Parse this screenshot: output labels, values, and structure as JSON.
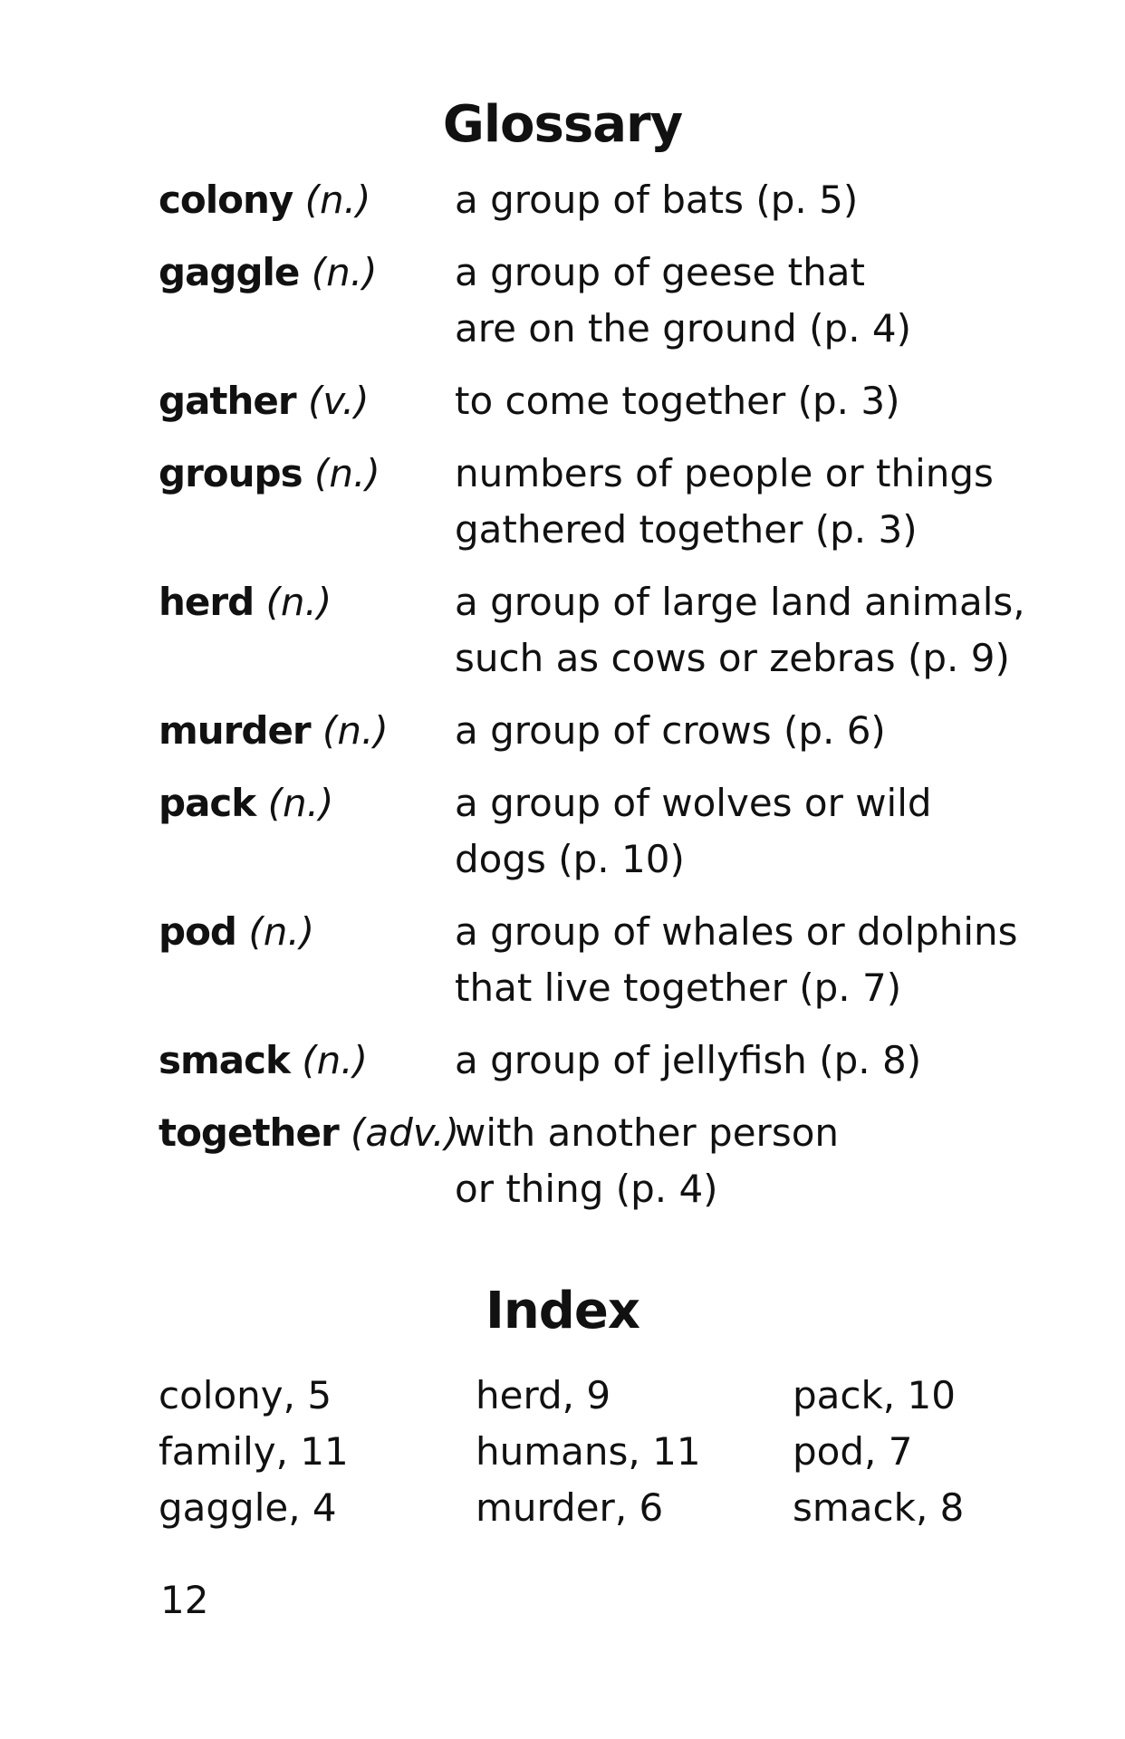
{
  "glossary": {
    "title": "Glossary",
    "entries": [
      {
        "term": "colony",
        "pos": "(n.)",
        "lines": [
          "a group of bats (p. 5)"
        ]
      },
      {
        "term": "gaggle",
        "pos": "(n.)",
        "lines": [
          "a group of geese that",
          "are on the ground (p. 4)"
        ]
      },
      {
        "term": "gather",
        "pos": "(v.)",
        "lines": [
          "to come together (p. 3)"
        ]
      },
      {
        "term": "groups",
        "pos": "(n.)",
        "lines": [
          "numbers of people or things",
          "gathered together (p. 3)"
        ]
      },
      {
        "term": "herd",
        "pos": "(n.)",
        "lines": [
          "a group of large land animals,",
          "such as cows or zebras (p. 9)"
        ]
      },
      {
        "term": "murder",
        "pos": "(n.)",
        "lines": [
          "a group of crows (p. 6)"
        ]
      },
      {
        "term": "pack",
        "pos": "(n.)",
        "lines": [
          "a group of wolves or wild",
          "dogs (p. 10)"
        ]
      },
      {
        "term": "pod",
        "pos": "(n.)",
        "lines": [
          "a group of whales or dolphins",
          "that live together (p. 7)"
        ]
      },
      {
        "term": "smack",
        "pos": "(n.)",
        "lines": [
          "a group of jellyfish (p. 8)"
        ]
      },
      {
        "term": "together",
        "pos": "(adv.)",
        "lines": [
          "with another person",
          "or thing (p. 4)"
        ]
      }
    ]
  },
  "index": {
    "title": "Index",
    "columns": [
      [
        "colony, 5",
        "family, 11",
        "gaggle, 4"
      ],
      [
        "herd, 9",
        "humans, 11",
        "murder, 6"
      ],
      [
        "pack, 10",
        "pod, 7",
        "smack, 8"
      ]
    ]
  },
  "page_number": "12"
}
